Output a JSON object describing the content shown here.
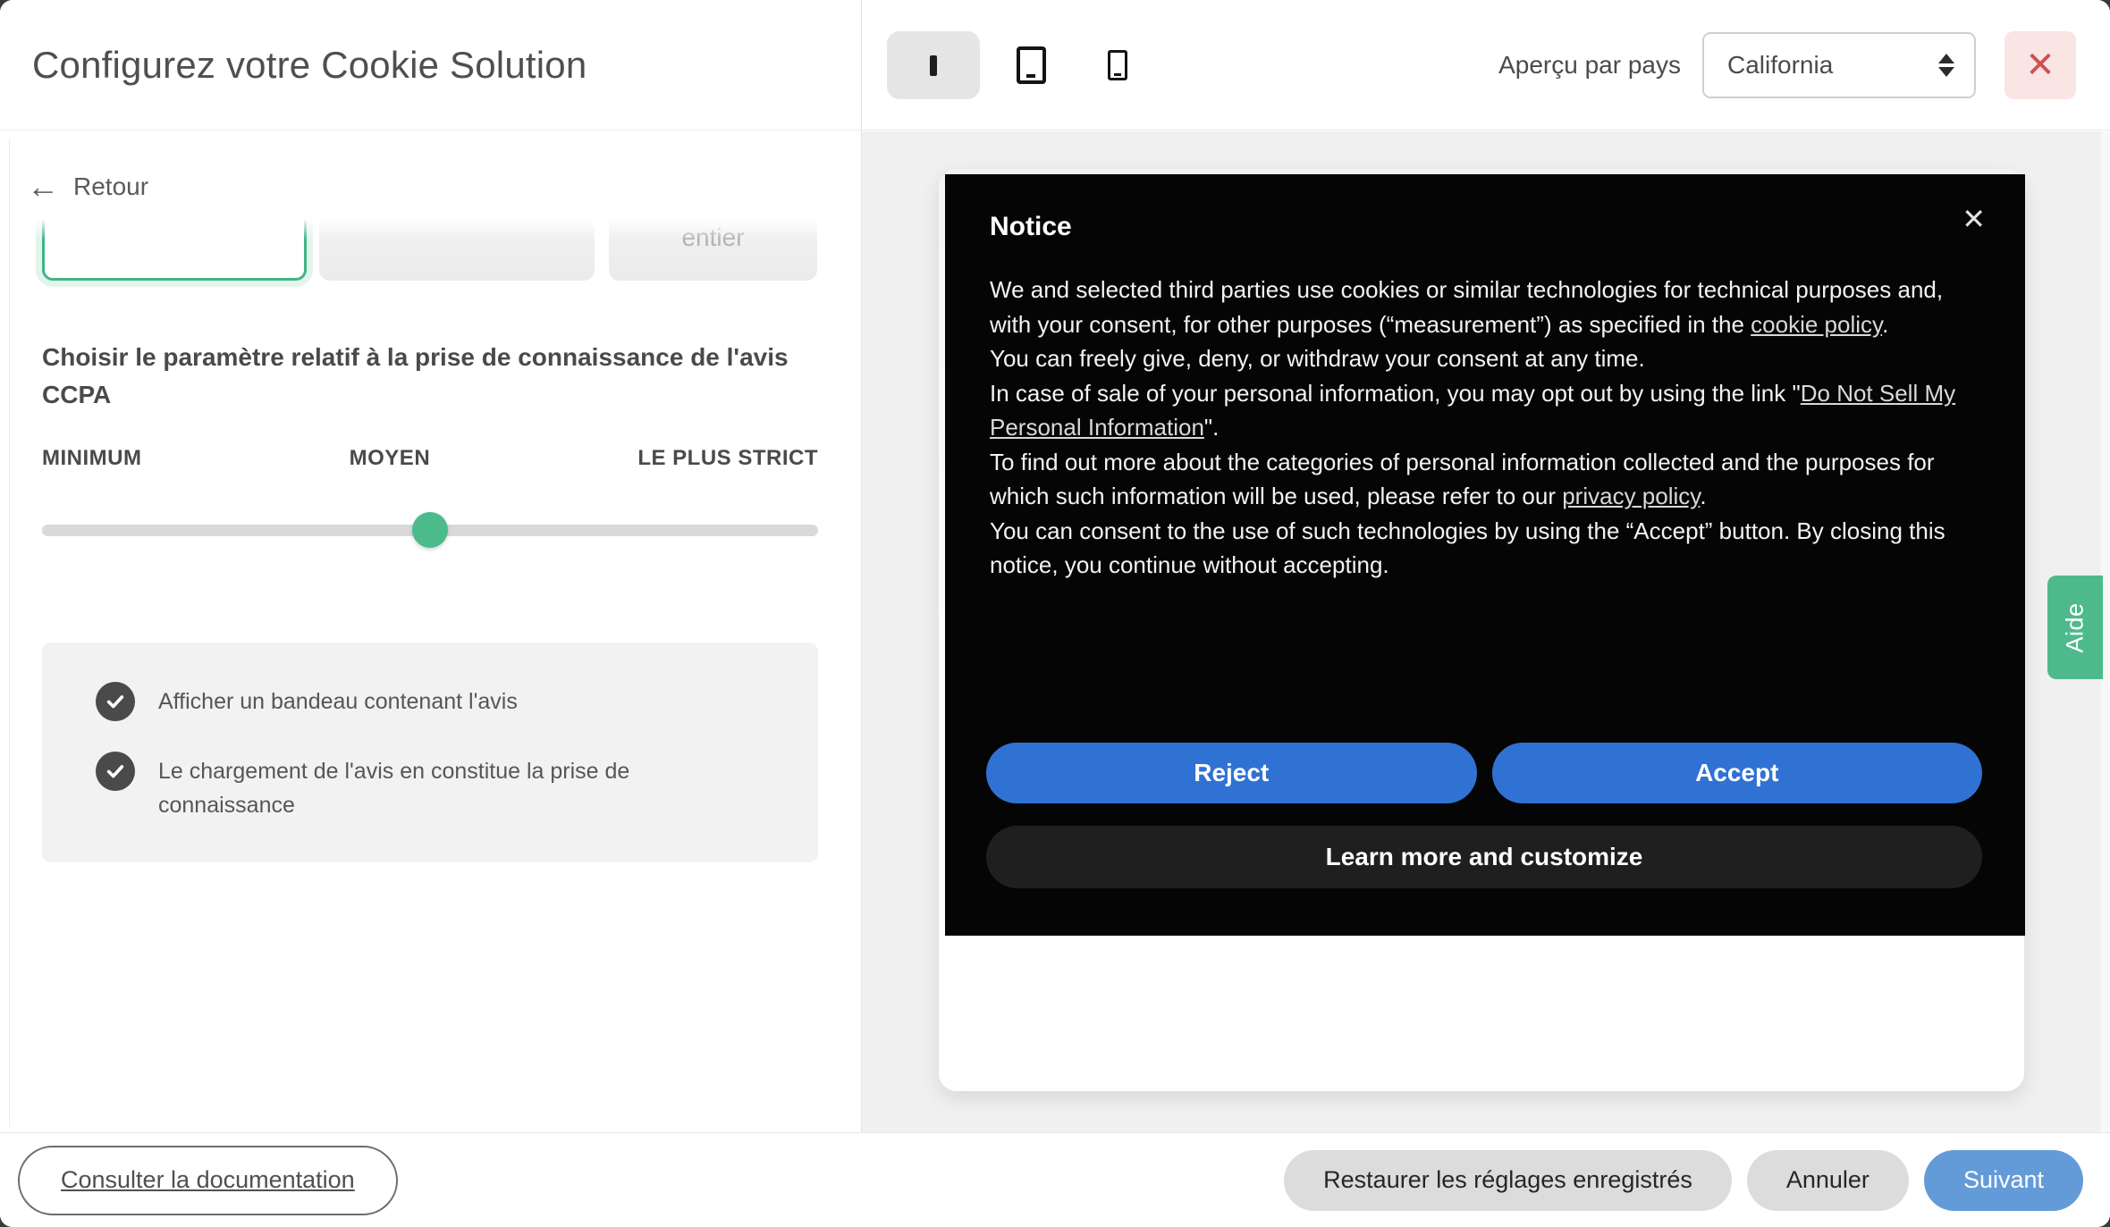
{
  "header": {
    "title": "Configurez votre Cookie Solution",
    "country_preview_label": "Aperçu par pays",
    "country_selected": "California",
    "close_glyph": "✕"
  },
  "device_toggle": {
    "selected": "desktop",
    "options": [
      "desktop",
      "tablet",
      "mobile"
    ]
  },
  "left_panel": {
    "back_arrow": "←",
    "back_label": "Retour",
    "partial_card_label": "entier",
    "ccpa_heading": "Choisir le paramètre relatif à la prise de connaissance de l'avis CCPA",
    "slider": {
      "label_min": "MINIMUM",
      "label_mid": "MOYEN",
      "label_max": "LE PLUS STRICT",
      "value": "MOYEN",
      "position_pct": 50
    },
    "options": [
      {
        "label": "Afficher un bandeau contenant l'avis",
        "checked": true
      },
      {
        "label": "Le chargement de l'avis en constitue la prise de connaissance",
        "checked": true
      }
    ]
  },
  "notice": {
    "title": "Notice",
    "close_glyph": "✕",
    "paragraphs": {
      "p1": {
        "s0": "We and selected third parties use cookies or similar technologies for technical purposes and, with your consent, for other purposes (“measurement”) as specified in the ",
        "link": "cookie policy",
        "s1": "."
      },
      "p2": {
        "s0": "You can freely give, deny, or withdraw your consent at any time."
      },
      "p3": {
        "s0": "In case of sale of your personal information, you may opt out by using the link \"",
        "link": "Do Not Sell My Personal Information",
        "s1": "\"."
      },
      "p4": {
        "s0": "To find out more about the categories of personal information collected and the purposes for which such information will be used, please refer to our ",
        "link": "privacy policy",
        "s1": "."
      },
      "p5": {
        "s0": "You can consent to the use of such technologies by using the “Accept” button. By closing this notice, you continue without accepting."
      }
    },
    "reject_label": "Reject",
    "accept_label": "Accept",
    "learn_more_label": "Learn more and customize"
  },
  "help_tab": {
    "label": "Aide"
  },
  "footer": {
    "docs_label": "Consulter la documentation",
    "restore_label": "Restaurer les réglages enregistrés",
    "cancel_label": "Annuler",
    "next_label": "Suivant"
  },
  "colors": {
    "accent_green": "#4cbb8c",
    "notice_button_blue": "#2f72d3",
    "next_button_blue": "#639bd9",
    "close_red": "#d05050",
    "notice_background": "#050505"
  }
}
